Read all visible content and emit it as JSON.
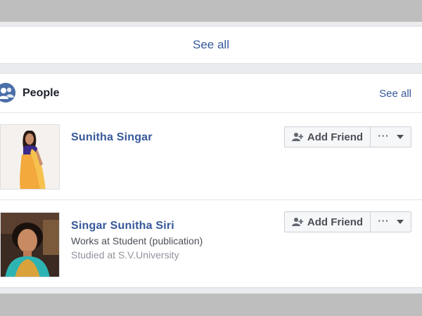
{
  "see_all_card": {
    "label": "See all"
  },
  "people": {
    "title": "People",
    "see_all": "See all",
    "icon": "people-icon",
    "accent_color": "#4a6ea8",
    "link_color": "#365899",
    "persons": [
      {
        "name": "Sunitha Singar",
        "work": "",
        "study": "",
        "add_friend_label": "Add Friend",
        "more_label": "···"
      },
      {
        "name": "Singar Sunitha Siri",
        "work": "Works at Student (publication)",
        "study": "Studied at S.V.University",
        "add_friend_label": "Add Friend",
        "more_label": "···"
      }
    ]
  }
}
